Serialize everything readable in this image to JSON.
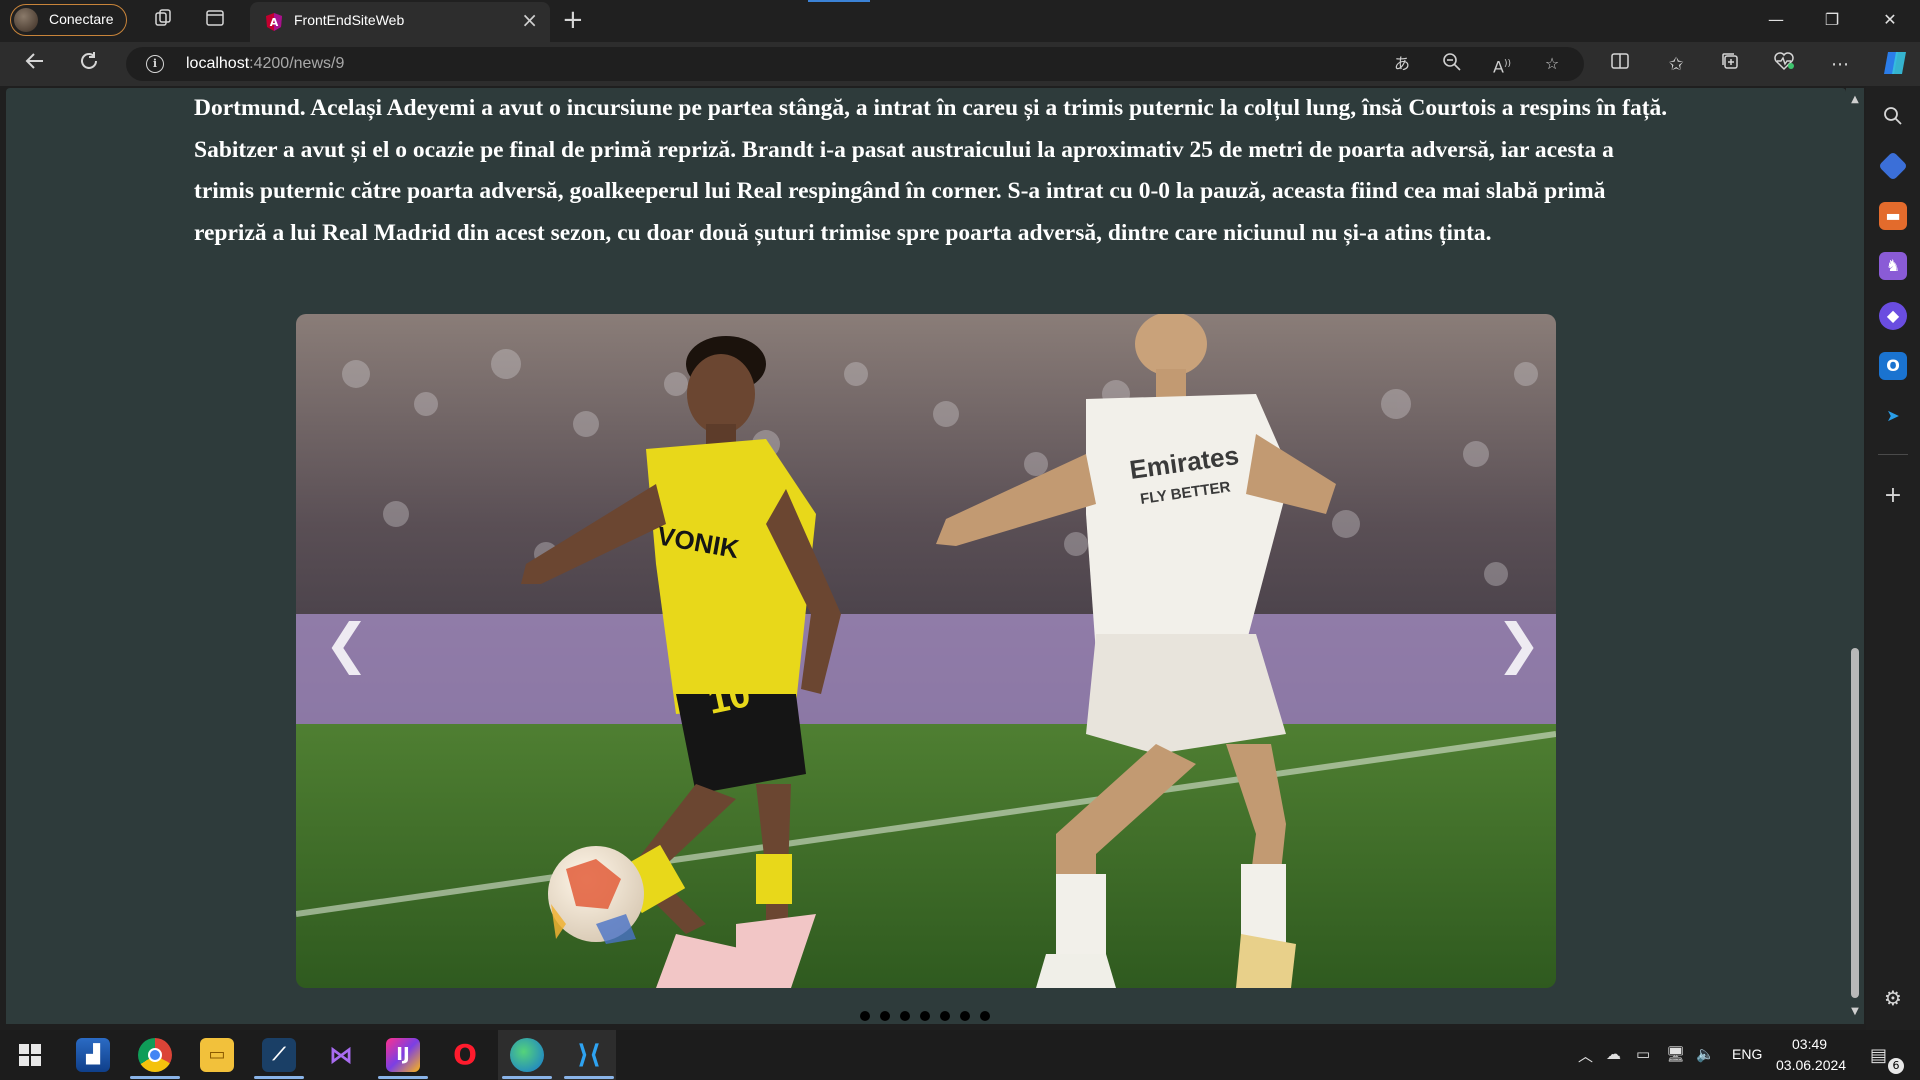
{
  "browser": {
    "profile_label": "Conectare",
    "tab_title": "FrontEndSiteWeb",
    "url_host": "localhost",
    "url_path": ":4200/news/9"
  },
  "article": {
    "text": "Dortmund. Același Adeyemi a avut o incursiune pe partea stângă, a intrat în careu și a trimis puternic la colțul lung, însă Courtois a respins în față. Sabitzer a avut și el o ocazie pe final de primă repriză. Brandt i-a pasat austraicului la aproximativ 25 de metri de poarta adversă, iar acesta a trimis puternic către poarta adversă, goalkeeperul lui Real respingând în corner. S-a intrat cu 0-0 la pauză, aceasta fiind cea mai slabă primă repriză a lui Real Madrid din acest sezon, cu doar două șuturi trimise spre poarta adversă, dintre care niciunul nu și-a atins ținta."
  },
  "carousel": {
    "prev": "❮",
    "next": "❯",
    "slide_count": 7,
    "photo_texts": {
      "sponsor_left": "VONIK",
      "shirt_number": "10",
      "sponsor_right": "Emirates",
      "slogan": "FLY BETTER"
    }
  },
  "taskbar": {
    "language": "ENG",
    "time": "03:49",
    "date": "03.06.2024",
    "notifications": "6"
  },
  "colors": {
    "page_bg": "#2e3b3b",
    "bvb_yellow": "#e8d81a",
    "real_white": "#f2f0ea",
    "pitch_green": "#3c6e2a"
  }
}
